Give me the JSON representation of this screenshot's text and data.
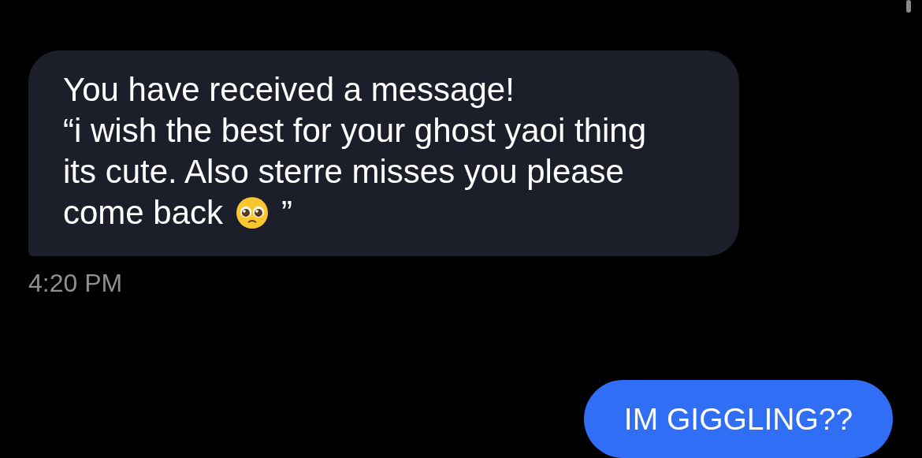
{
  "messages": [
    {
      "kind": "received",
      "lines": [
        "You have received a message!",
        "“i wish the best for your ghost yaoi thing",
        "its cute. Also sterre misses you please",
        "come back"
      ],
      "emoji": true,
      "closing": "”",
      "time": "4:20 PM"
    },
    {
      "kind": "sent",
      "lines": [
        "IM GIGGLING??"
      ]
    }
  ]
}
